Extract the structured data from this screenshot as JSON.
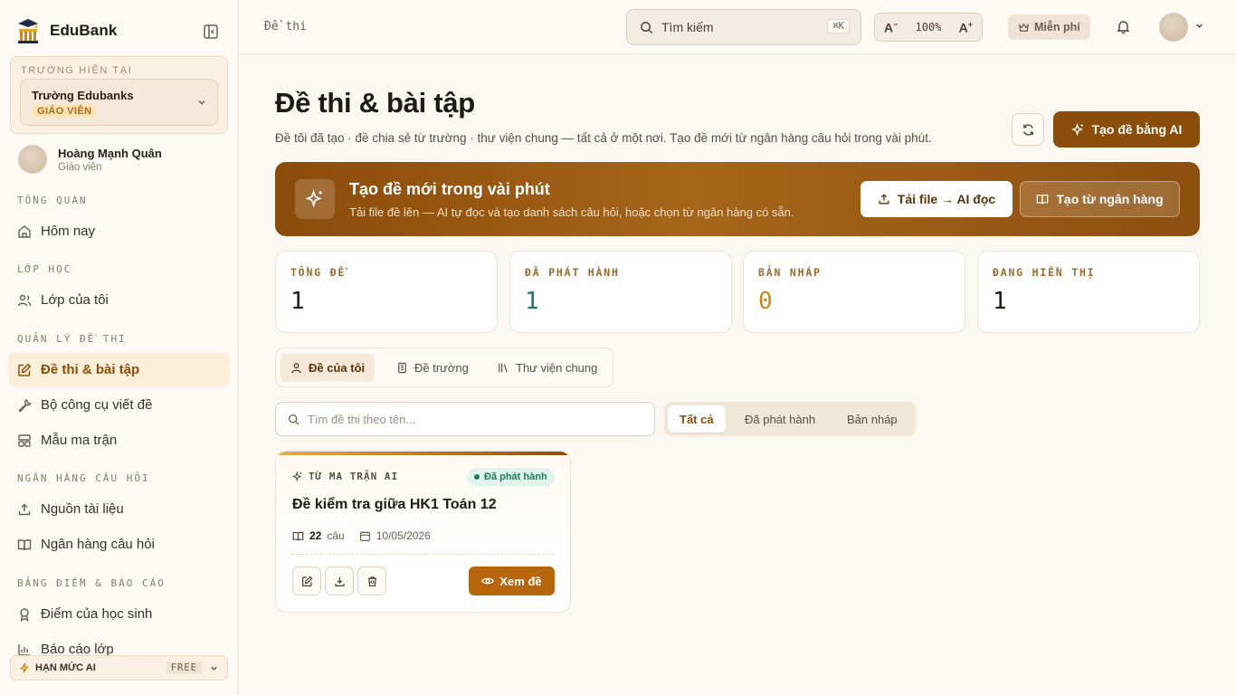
{
  "app": {
    "name": "EduBank"
  },
  "school": {
    "caption": "TRƯỜNG HIỆN TẠI",
    "name": "Trường Edubanks",
    "role": "GIÁO VIÊN"
  },
  "user": {
    "name": "Hoàng Mạnh Quân",
    "role": "Giáo viên"
  },
  "sidebar": {
    "sections": {
      "overview": "TỔNG QUAN",
      "classes": "LỚP HỌC",
      "exam_mgmt": "QUẢN LÝ ĐỀ THI",
      "question_bank": "NGÂN HÀNG CÂU HỎI",
      "reports": "BẢNG ĐIỂM & BÁO CÁO"
    },
    "items": {
      "today": "Hôm nay",
      "my_classes": "Lớp của tôi",
      "exams": "Đề thi & bài tập",
      "toolkit": "Bộ công cụ viết đề",
      "matrix": "Mẫu ma trận",
      "sources": "Nguồn tài liệu",
      "bank": "Ngân hàng câu hỏi",
      "scores": "Điểm của học sinh",
      "class_reports": "Báo cáo lớp"
    },
    "quota": {
      "label": "HẠN MỨC AI",
      "plan": "FREE"
    }
  },
  "topbar": {
    "breadcrumb": "Đề thi",
    "search_placeholder": "Tìm kiếm",
    "search_shortcut": "⌘K",
    "zoom_out": "A",
    "zoom_level": "100%",
    "zoom_in": "A",
    "plan_label": "Miễn phí"
  },
  "page": {
    "title": "Đề thi & bài tập",
    "subtitle": "Đề tôi đã tạo · đề chia sẻ từ trường · thư viện chung — tất cả ở một nơi. Tạo đề mới từ ngân hàng câu hỏi trong vài phút.",
    "ai_button": "Tạo đề bằng AI"
  },
  "banner": {
    "title": "Tạo đề mới trong vài phút",
    "subtitle": "Tải file đề lên — AI tự đọc và tạo danh sách câu hỏi, hoặc chọn từ ngân hàng có sẵn.",
    "upload_button": "Tải file → AI đọc",
    "bank_button": "Tạo từ ngân hàng"
  },
  "stats": [
    {
      "label": "TỔNG ĐỀ",
      "value": "1",
      "color": "#1f1a14"
    },
    {
      "label": "ĐÃ PHÁT HÀNH",
      "value": "1",
      "color": "#1f7a5c"
    },
    {
      "label": "BẢN NHÁP",
      "value": "0",
      "color": "#c48a1a"
    },
    {
      "label": "ĐANG HIỂN THỊ",
      "value": "1",
      "color": "#1f1a14"
    }
  ],
  "tabs": {
    "mine": "Đề của tôi",
    "school": "Đề trường",
    "library": "Thư viện chung"
  },
  "filter": {
    "placeholder": "Tìm đề thi theo tên...",
    "all": "Tất cả",
    "published": "Đã phát hành",
    "draft": "Bản nháp"
  },
  "exam_card": {
    "source": "TỪ MA TRẬN AI",
    "status": "Đã phát hành",
    "title": "Đề kiểm tra giữa HK1 Toán 12",
    "question_count": "22",
    "question_unit": "câu",
    "date": "10/05/2026",
    "view_button": "Xem đề"
  },
  "colors": {
    "accent": "#8b4e0a",
    "success": "#1f7a5c",
    "warning": "#c48a1a"
  }
}
